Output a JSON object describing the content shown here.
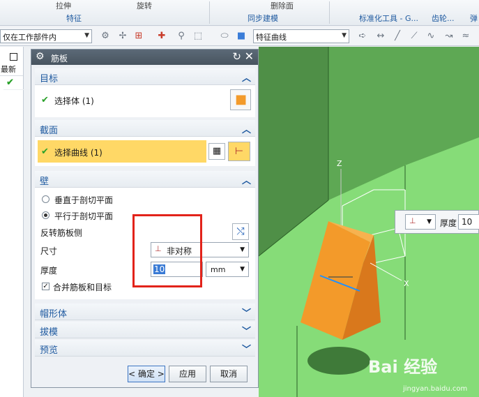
{
  "ribbon": {
    "top_labels": [
      "拉伸",
      "旋转",
      "删除面"
    ],
    "groups": [
      "特征",
      "同步建模",
      "标准化工具 - G...",
      "齿轮...",
      "弹"
    ]
  },
  "toolbar": {
    "scope": "仅在工作部件内",
    "curve_rule": "特征曲线"
  },
  "leftnav": {
    "header": "最新",
    "checks": [
      "✔",
      "✔",
      "✔",
      "✔",
      "✔",
      "✔",
      "✔",
      "✔"
    ]
  },
  "dialog": {
    "title": "筋板",
    "sections": {
      "target": {
        "label": "目标",
        "select_body": "选择体 (1)"
      },
      "section": {
        "label": "截面",
        "select_curve": "选择曲线 (1)"
      },
      "wall": {
        "label": "壁",
        "opt_perpendicular": "垂直于剖切平面",
        "opt_parallel": "平行于剖切平面",
        "reverse": "反转筋板侧",
        "size_label": "尺寸",
        "size_value": "非对称",
        "thickness_label": "厚度",
        "thickness_value": "10",
        "unit": "mm",
        "merge": "合并筋板和目标"
      },
      "cap": {
        "label": "帽形体"
      },
      "draft": {
        "label": "拔模"
      },
      "preview": {
        "label": "预览"
      }
    },
    "buttons": {
      "ok": "< 确定 >",
      "apply": "应用",
      "cancel": "取消"
    }
  },
  "viewport": {
    "axis_z": "Z",
    "axis_x": "X",
    "float_thickness_label": "厚度",
    "float_thickness_value": "10"
  },
  "watermark": {
    "main": "Bai 经验",
    "sub": "jingyan.baidu.com"
  },
  "colors": {
    "model_green": "#7dd66e",
    "rib_orange": "#f39a2a",
    "highlight": "#ffd866",
    "red_box": "#e2231a"
  }
}
